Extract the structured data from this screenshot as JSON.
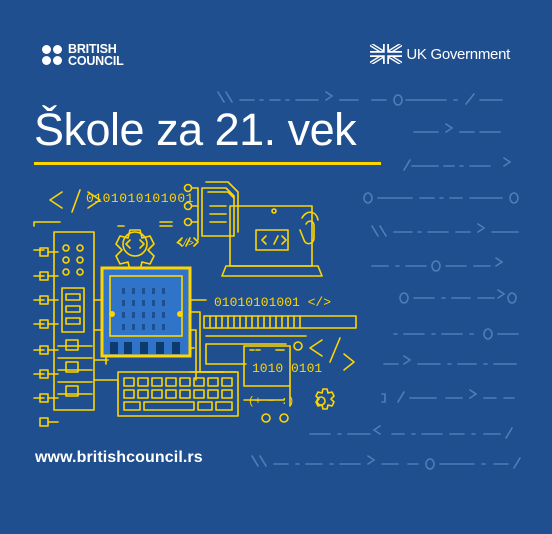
{
  "brand": {
    "logo_line1": "BRITISH",
    "logo_line2": "COUNCIL",
    "partner": "UK Government"
  },
  "hero": {
    "title": "Škole za 21. vek"
  },
  "illustration": {
    "binary_top": "0101010101001",
    "binary_mid": "01010101001 </>",
    "binary_low": "1010 0101",
    "code_tag": "</>",
    "symbols": "(+ − :)"
  },
  "footer": {
    "url": "www.britishcouncil.rs"
  },
  "colors": {
    "background": "#1f4f8f",
    "accent": "#ffd500",
    "microbit": "#2f74c9",
    "code_stream": "#4f7fb8",
    "text": "#ffffff"
  }
}
